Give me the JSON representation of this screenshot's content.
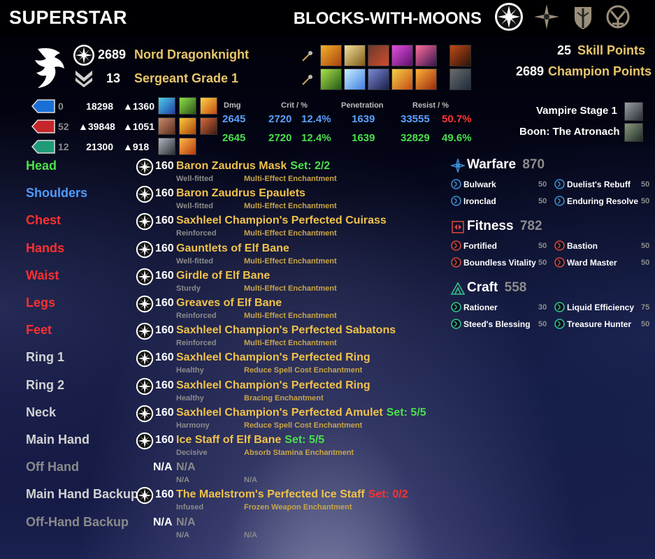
{
  "header": {
    "title": "SUPERSTAR",
    "character_name": "BLOCKS-WITH-MOONS",
    "icons": [
      "alliance-star-icon",
      "compass-icon",
      "shield-icon",
      "guild-crest-icon"
    ]
  },
  "profile": {
    "champion_rank": "2689",
    "race_class": "Nord Dragonknight",
    "pvp_rank": "13",
    "pvp_title": "Sergeant Grade 1",
    "skill_points_value": "25",
    "skill_points_label": "Skill Points",
    "champion_points_value": "2689",
    "champion_points_label": "Champion Points",
    "vampire": "Vampire Stage 1",
    "boon": "Boon: The Atronach"
  },
  "attributes": [
    {
      "gem": "magicka",
      "points": "0",
      "max": "18298",
      "regen": "1360"
    },
    {
      "gem": "health",
      "points": "52",
      "max": "39848",
      "regen": "1051"
    },
    {
      "gem": "stamina",
      "points": "12",
      "max": "21300",
      "regen": "918"
    }
  ],
  "combat_stats": {
    "headers": {
      "dmg": "Dmg",
      "crit": "Crit / %",
      "pen": "Penetration",
      "resist": "Resist / %"
    },
    "spell": {
      "dmg": "2645",
      "crit": "2720",
      "crit_pct": "12.4%",
      "pen": "1639",
      "resist": "33555",
      "resist_pct": "50.7%"
    },
    "weapon": {
      "dmg": "2645",
      "crit": "2720",
      "crit_pct": "12.4%",
      "pen": "1639",
      "resist": "32829",
      "resist_pct": "49.6%"
    }
  },
  "equipment": [
    {
      "slot": "Head",
      "slot_color": "green",
      "level": "160",
      "name": "Baron Zaudrus Mask",
      "set": "Set: 2/2",
      "set_color": "green",
      "trait": "Well-fitted",
      "enchant": "Multi-Effect Enchantment"
    },
    {
      "slot": "Shoulders",
      "slot_color": "blue",
      "level": "160",
      "name": "Baron Zaudrus Epaulets",
      "set": "",
      "set_color": "",
      "trait": "Well-fitted",
      "enchant": "Multi-Effect Enchantment"
    },
    {
      "slot": "Chest",
      "slot_color": "red",
      "level": "160",
      "name": "Saxhleel Champion's Perfected Cuirass",
      "set": "",
      "set_color": "",
      "trait": "Reinforced",
      "enchant": "Multi-Effect Enchantment"
    },
    {
      "slot": "Hands",
      "slot_color": "red",
      "level": "160",
      "name": "Gauntlets of Elf Bane",
      "set": "",
      "set_color": "",
      "trait": "Well-fitted",
      "enchant": "Multi-Effect Enchantment"
    },
    {
      "slot": "Waist",
      "slot_color": "red",
      "level": "160",
      "name": "Girdle of Elf Bane",
      "set": "",
      "set_color": "",
      "trait": "Sturdy",
      "enchant": "Multi-Effect Enchantment"
    },
    {
      "slot": "Legs",
      "slot_color": "red",
      "level": "160",
      "name": "Greaves of Elf Bane",
      "set": "",
      "set_color": "",
      "trait": "Reinforced",
      "enchant": "Multi-Effect Enchantment"
    },
    {
      "slot": "Feet",
      "slot_color": "red",
      "level": "160",
      "name": "Saxhleel Champion's Perfected Sabatons",
      "set": "",
      "set_color": "",
      "trait": "Reinforced",
      "enchant": "Multi-Effect Enchantment"
    },
    {
      "slot": "Ring 1",
      "slot_color": "gray",
      "level": "160",
      "name": "Saxhleel Champion's Perfected Ring",
      "set": "",
      "set_color": "",
      "trait": "Healthy",
      "enchant": "Reduce Spell Cost Enchantment"
    },
    {
      "slot": "Ring 2",
      "slot_color": "gray",
      "level": "160",
      "name": "Saxhleel Champion's Perfected Ring",
      "set": "",
      "set_color": "",
      "trait": "Healthy",
      "enchant": "Bracing Enchantment"
    },
    {
      "slot": "Neck",
      "slot_color": "gray",
      "level": "160",
      "name": "Saxhleel Champion's Perfected Amulet",
      "set": "Set: 5/5",
      "set_color": "green",
      "trait": "Harmony",
      "enchant": "Reduce Spell Cost Enchantment"
    },
    {
      "slot": "Main Hand",
      "slot_color": "gray",
      "level": "160",
      "name": "Ice Staff of Elf Bane",
      "set": "Set: 5/5",
      "set_color": "green",
      "trait": "Decisive",
      "enchant": "Absorb Stamina Enchantment"
    },
    {
      "slot": "Off Hand",
      "slot_color": "dim",
      "level": "N/A",
      "name": "N/A",
      "set": "",
      "set_color": "",
      "trait": "N/A",
      "enchant": "N/A"
    },
    {
      "slot": "Main Hand Backup",
      "slot_color": "gray",
      "level": "160",
      "name": "The Maelstrom's Perfected Ice Staff",
      "set": "Set: 0/2",
      "set_color": "red",
      "trait": "Infused",
      "enchant": "Frozen Weapon Enchantment"
    },
    {
      "slot": "Off-Hand Backup",
      "slot_color": "dim",
      "level": "N/A",
      "name": "N/A",
      "set": "",
      "set_color": "",
      "trait": "N/A",
      "enchant": "N/A"
    }
  ],
  "champion": [
    {
      "name": "Warfare",
      "points": "870",
      "color": "#3b8fd6",
      "icon": "warfare-icon",
      "items": [
        {
          "name": "Bulwark",
          "value": "50"
        },
        {
          "name": "Duelist's Rebuff",
          "value": "50"
        },
        {
          "name": "Ironclad",
          "value": "50"
        },
        {
          "name": "Enduring Resolve",
          "value": "50"
        }
      ]
    },
    {
      "name": "Fitness",
      "points": "782",
      "color": "#d6463b",
      "icon": "fitness-icon",
      "items": [
        {
          "name": "Fortified",
          "value": "50"
        },
        {
          "name": "Bastion",
          "value": "50"
        },
        {
          "name": "Boundless Vitality",
          "value": "50"
        },
        {
          "name": "Ward Master",
          "value": "50"
        }
      ]
    },
    {
      "name": "Craft",
      "points": "558",
      "color": "#34c28a",
      "icon": "craft-icon",
      "items": [
        {
          "name": "Rationer",
          "value": "30"
        },
        {
          "name": "Liquid Efficiency",
          "value": "75"
        },
        {
          "name": "Steed's Blessing",
          "value": "50"
        },
        {
          "name": "Treasure Hunter",
          "value": "50"
        }
      ]
    }
  ],
  "colors": {
    "green": "#4be04b",
    "blue": "#4f9bff",
    "red": "#ff3030",
    "gray": "#d2d2d2",
    "dim": "#8a8a8a",
    "gold": "#f0c24a",
    "magicka": "#1a6fd6",
    "health": "#c5262b",
    "stamina": "#1f9b78"
  }
}
